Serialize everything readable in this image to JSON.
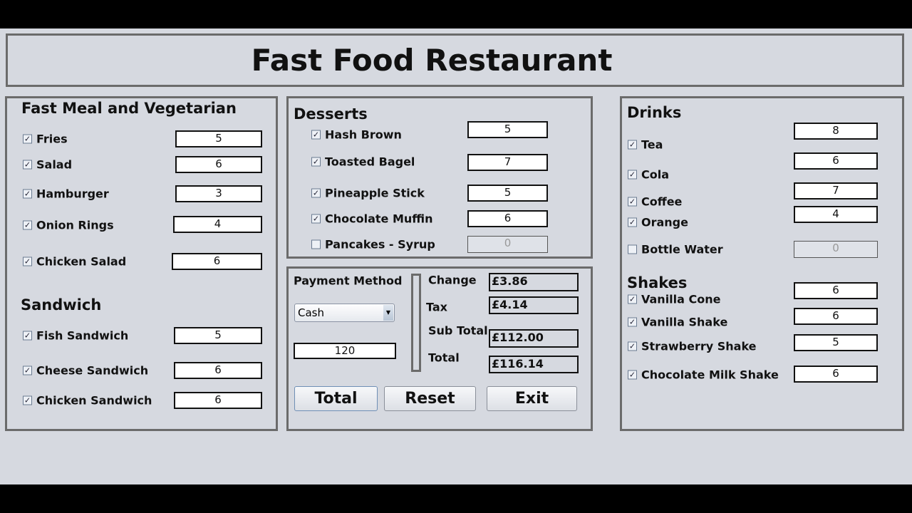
{
  "title": "Fast Food Restaurant",
  "fast_meal": {
    "heading": "Fast Meal and Vegetarian",
    "items": [
      {
        "label": "Fries",
        "checked": true,
        "qty": "5"
      },
      {
        "label": "Salad",
        "checked": true,
        "qty": "6"
      },
      {
        "label": "Hamburger",
        "checked": true,
        "qty": "3"
      },
      {
        "label": "Onion Rings",
        "checked": true,
        "qty": "4"
      },
      {
        "label": "Chicken Salad",
        "checked": true,
        "qty": "6"
      }
    ]
  },
  "sandwich": {
    "heading": "Sandwich",
    "items": [
      {
        "label": "Fish Sandwich",
        "checked": true,
        "qty": "5"
      },
      {
        "label": "Cheese Sandwich",
        "checked": true,
        "qty": "6"
      },
      {
        "label": "Chicken Sandwich",
        "checked": true,
        "qty": "6"
      }
    ]
  },
  "desserts": {
    "heading": "Desserts",
    "items": [
      {
        "label": "Hash Brown",
        "checked": true,
        "qty": "5"
      },
      {
        "label": "Toasted Bagel",
        "checked": true,
        "qty": "7"
      },
      {
        "label": "Pineapple Stick",
        "checked": true,
        "qty": "5"
      },
      {
        "label": "Chocolate Muffin",
        "checked": true,
        "qty": "6"
      },
      {
        "label": "Pancakes - Syrup",
        "checked": false,
        "qty": "0"
      }
    ]
  },
  "drinks": {
    "heading": "Drinks",
    "items": [
      {
        "label": "Tea",
        "checked": true,
        "qty": "8"
      },
      {
        "label": "Cola",
        "checked": true,
        "qty": "6"
      },
      {
        "label": "Coffee",
        "checked": true,
        "qty": "7"
      },
      {
        "label": "Orange",
        "checked": true,
        "qty": "4"
      },
      {
        "label": "Bottle Water",
        "checked": false,
        "qty": "0"
      }
    ]
  },
  "shakes": {
    "heading": "Shakes",
    "items": [
      {
        "label": "Vanilla Cone",
        "checked": true,
        "qty": "6"
      },
      {
        "label": "Vanilla Shake",
        "checked": true,
        "qty": "6"
      },
      {
        "label": "Strawberry Shake",
        "checked": true,
        "qty": "5"
      },
      {
        "label": "Chocolate Milk Shake",
        "checked": true,
        "qty": "6"
      }
    ]
  },
  "payment": {
    "label": "Payment Method",
    "method": "Cash",
    "amount": "120",
    "change_label": "Change",
    "change": "£3.86",
    "tax_label": "Tax",
    "tax": "£4.14",
    "subtotal_label": "Sub Total",
    "subtotal": "£112.00",
    "total_label": "Total",
    "total": "£116.14"
  },
  "buttons": {
    "total": "Total",
    "reset": "Reset",
    "exit": "Exit"
  }
}
